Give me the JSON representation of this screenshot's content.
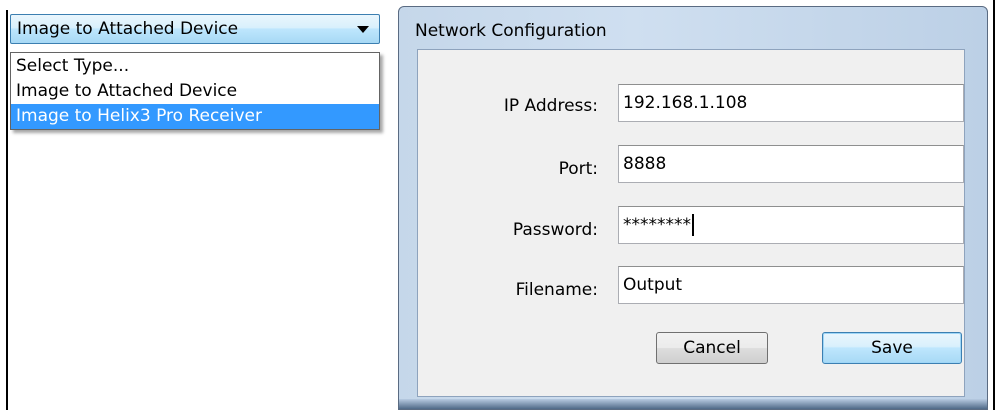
{
  "dropdown": {
    "selected": "Image to Attached Device",
    "options": [
      "Select Type...",
      "Image to Attached Device",
      "Image to Helix3 Pro Receiver"
    ],
    "highlighted_index": 2,
    "arrow_icon": "chevron-down-icon"
  },
  "dialog": {
    "title": "Network Configuration",
    "fields": {
      "ip": {
        "label": "IP Address:",
        "value": "192.168.1.108"
      },
      "port": {
        "label": "Port:",
        "value": "8888"
      },
      "password": {
        "label": "Password:",
        "value": "********"
      },
      "filename": {
        "label": "Filename:",
        "value": "Output"
      }
    },
    "buttons": {
      "cancel": "Cancel",
      "save": "Save"
    }
  },
  "colors": {
    "selection": "#3399ff",
    "window_frame": "#c5d7ea",
    "client_bg": "#f0f0f0"
  }
}
